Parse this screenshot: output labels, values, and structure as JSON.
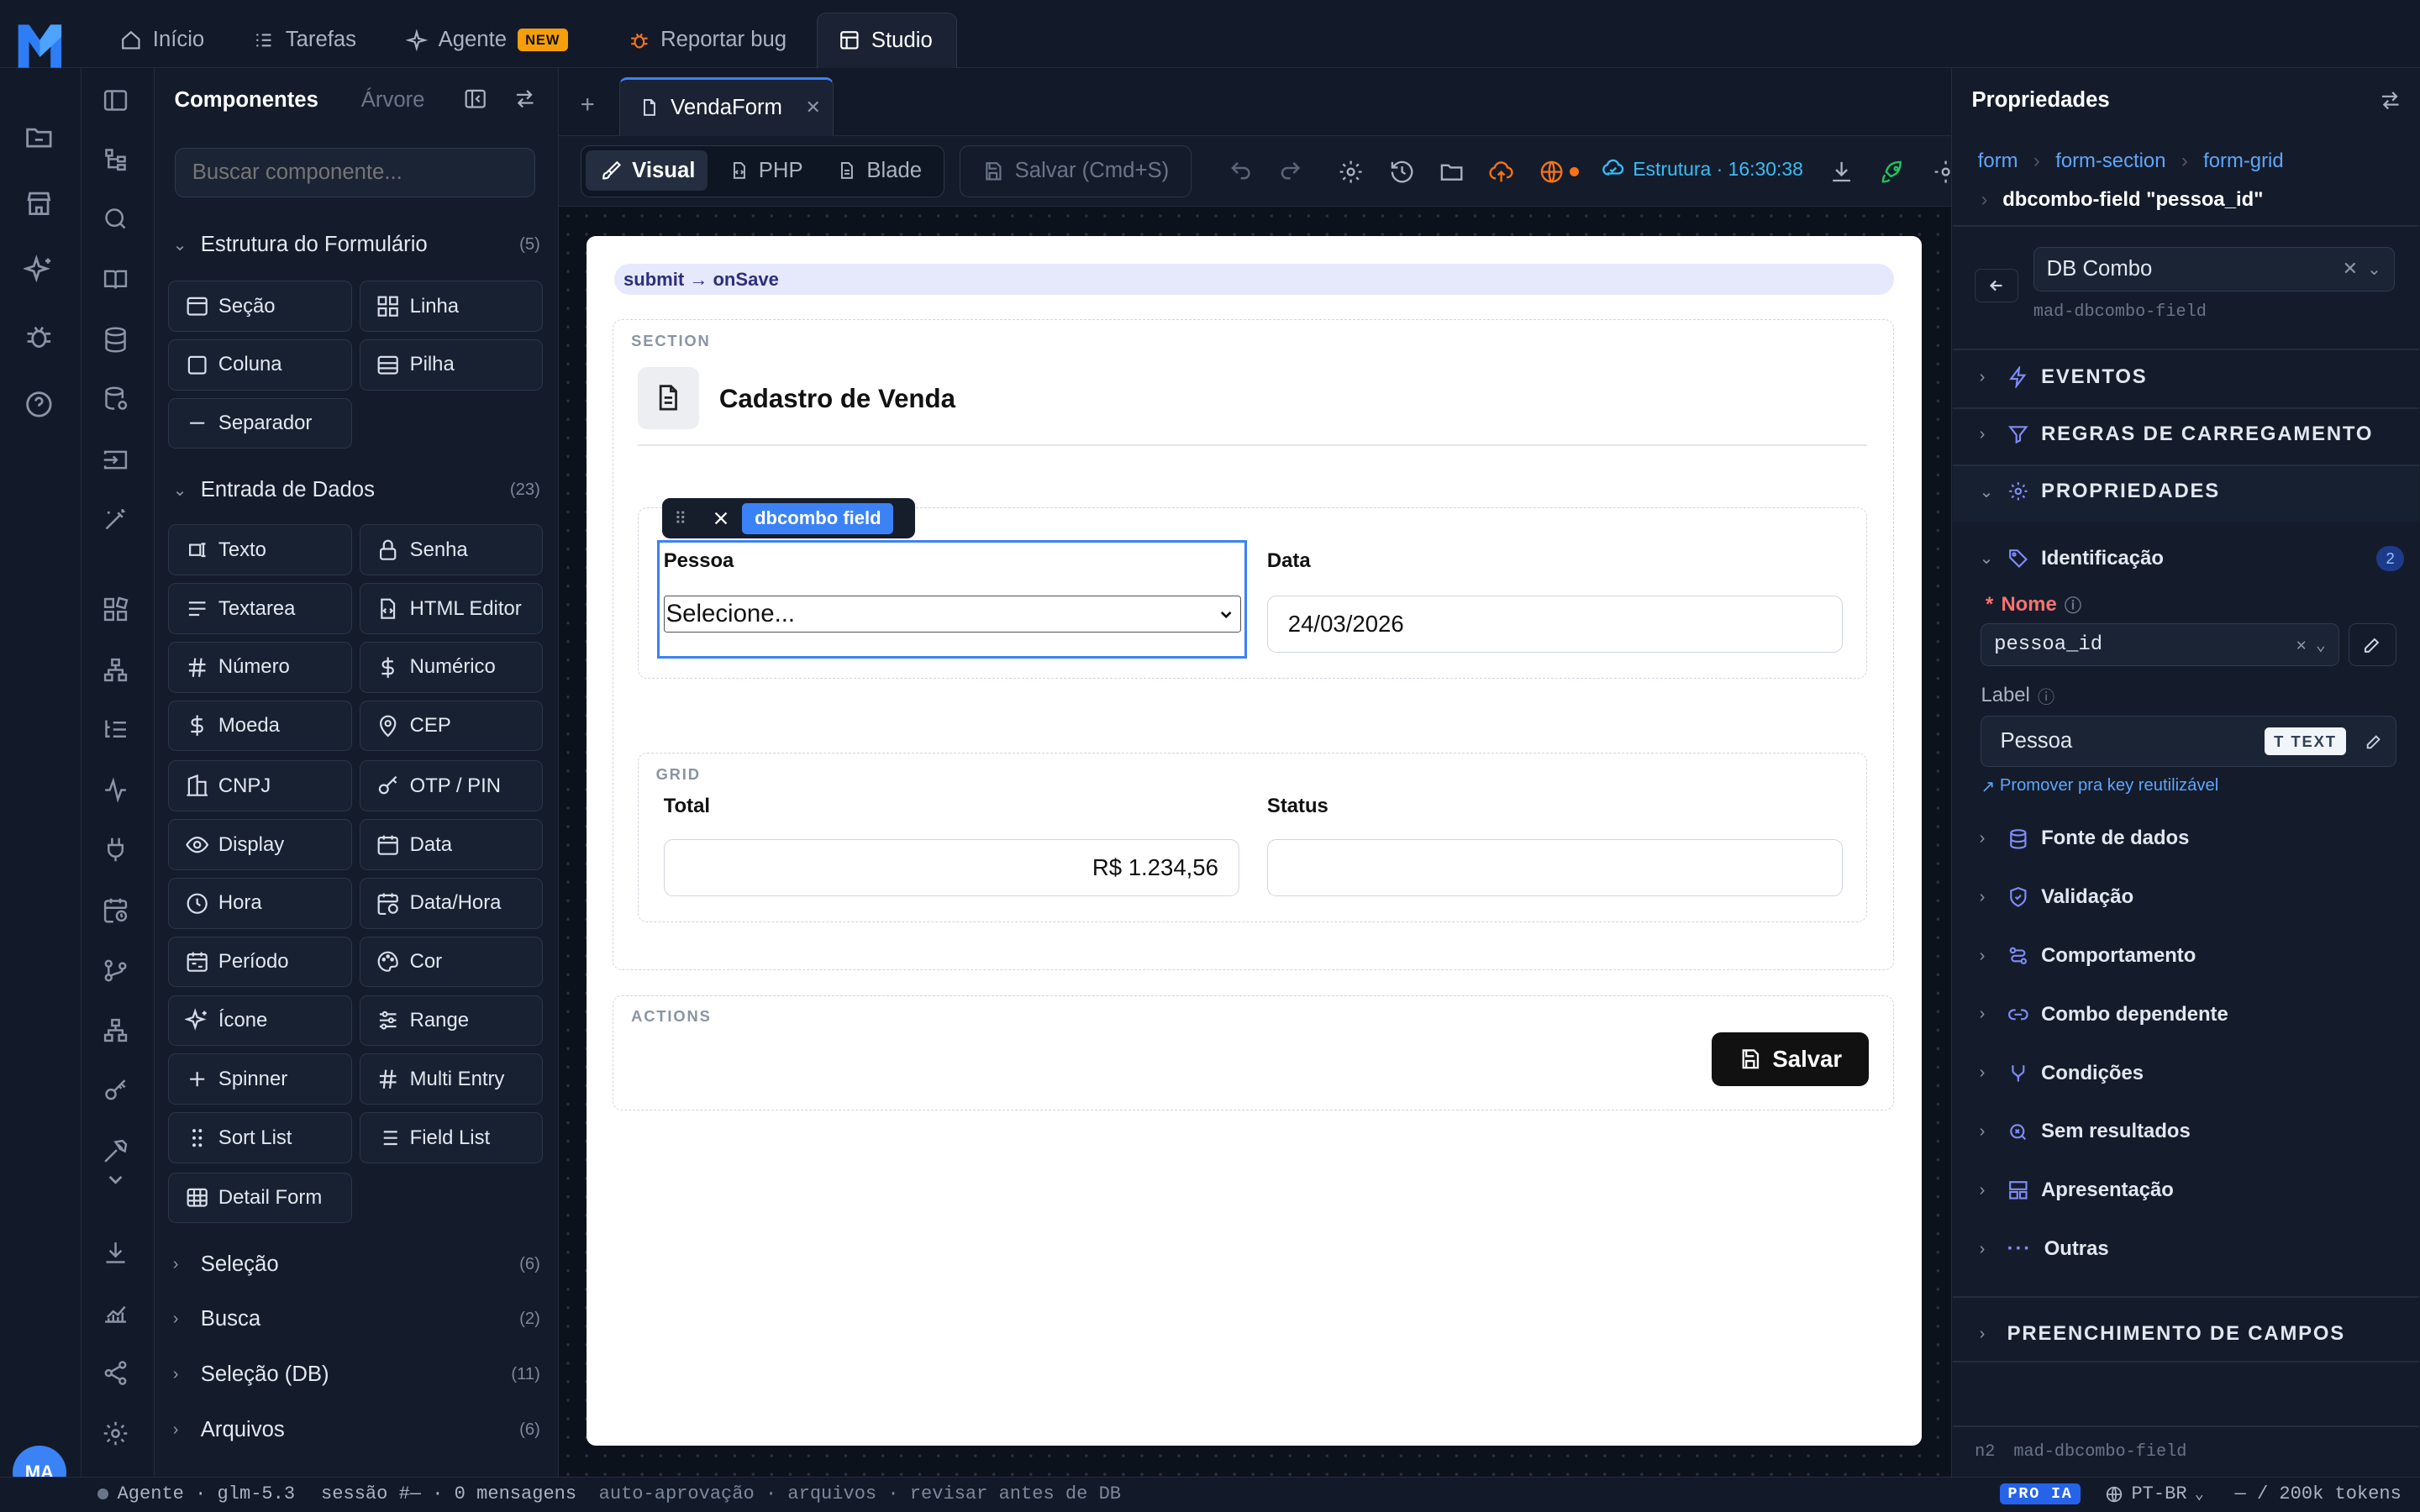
{
  "top_nav": {
    "tabs": [
      {
        "label": "Início",
        "icon": "home-icon"
      },
      {
        "label": "Tarefas",
        "icon": "tasks-icon"
      },
      {
        "label": "Agente",
        "icon": "sparkle-icon",
        "badge": "NEW"
      },
      {
        "label": "Reportar bug",
        "icon": "bug-icon"
      },
      {
        "label": "Studio",
        "icon": "layout-icon",
        "active": true
      }
    ]
  },
  "left_rail": {
    "avatar": "MA"
  },
  "components_panel": {
    "tab_components": "Componentes",
    "tab_tree": "Árvore",
    "search_placeholder": "Buscar componente...",
    "sections": [
      {
        "title": "Estrutura do Formulário",
        "count": "(5)",
        "expanded": true,
        "items": [
          "Seção",
          "Linha",
          "Coluna",
          "Pilha",
          "Separador"
        ]
      },
      {
        "title": "Entrada de Dados",
        "count": "(23)",
        "expanded": true,
        "items": [
          "Texto",
          "Senha",
          "Textarea",
          "HTML Editor",
          "Número",
          "Numérico",
          "Moeda",
          "CEP",
          "CNPJ",
          "OTP / PIN",
          "Display",
          "Data",
          "Hora",
          "Data/Hora",
          "Período",
          "Cor",
          "Ícone",
          "Range",
          "Spinner",
          "Multi Entry",
          "Sort List",
          "Field List",
          "Detail Form"
        ]
      },
      {
        "title": "Seleção",
        "count": "(6)",
        "expanded": false
      },
      {
        "title": "Busca",
        "count": "(2)",
        "expanded": false
      },
      {
        "title": "Seleção (DB)",
        "count": "(11)",
        "expanded": false
      },
      {
        "title": "Arquivos",
        "count": "(6)",
        "expanded": false
      }
    ]
  },
  "editor": {
    "file_tab": "VendaForm",
    "view_modes": [
      "Visual",
      "PHP",
      "Blade"
    ],
    "active_mode": "Visual",
    "save_label": "Salvar (Cmd+S)",
    "structure_status": "Estrutura · 16:30:38"
  },
  "form": {
    "submit_hint": "submit → onSave",
    "section_label": "SECTION",
    "title": "Cadastro de Venda",
    "selection_toolbar_label": "dbcombo field",
    "row_fields": [
      {
        "label": "Pessoa",
        "type": "select",
        "value": "Selecione..."
      },
      {
        "label": "Data",
        "type": "input",
        "value": "24/03/2026"
      }
    ],
    "grid_label": "GRID",
    "grid_fields": [
      {
        "label": "Total",
        "value": "R$ 1.234,56"
      },
      {
        "label": "Status",
        "value": ""
      }
    ],
    "actions_label": "ACTIONS",
    "save_button": "Salvar"
  },
  "properties": {
    "title": "Propriedades",
    "breadcrumb": [
      "form",
      "form-section",
      "form-grid"
    ],
    "selected": "dbcombo-field \"pessoa_id\"",
    "component_type": "DB Combo",
    "component_id": "mad-dbcombo-field",
    "groups": [
      "EVENTOS",
      "REGRAS DE CARREGAMENTO",
      "PROPRIEDADES"
    ],
    "identification": {
      "title": "Identificação",
      "count": "2",
      "name_label": "Nome",
      "name_value": "pessoa_id",
      "label_label": "Label",
      "label_value": "Pessoa",
      "label_type": "TEXT",
      "promote_link": "Promover pra key reutilizável"
    },
    "subgroups": [
      {
        "label": "Fonte de dados",
        "icon": "database-icon"
      },
      {
        "label": "Validação",
        "icon": "shield-icon"
      },
      {
        "label": "Comportamento",
        "icon": "route-icon"
      },
      {
        "label": "Combo dependente",
        "icon": "link-icon"
      },
      {
        "label": "Condições",
        "icon": "branch-icon"
      },
      {
        "label": "Sem resultados",
        "icon": "search-icon"
      },
      {
        "label": "Apresentação",
        "icon": "layout-icon"
      },
      {
        "label": "Outras",
        "icon": "dots-icon"
      }
    ],
    "fill_group": "PREENCHIMENTO DE CAMPOS",
    "footer_level": "n2",
    "footer_id": "mad-dbcombo-field"
  },
  "status_bar": {
    "agent": "Agente · glm-5.3",
    "session": "sessão #— · 0 mensagens",
    "mode": "auto-aprovação · arquivos · revisar antes de DB",
    "plan_badge": "PRO IA",
    "language": "PT-BR",
    "tokens": "— / 200k tokens"
  },
  "colors": {
    "accent": "#3b82f6",
    "brand_blue": "#2563eb",
    "badge_orange": "#f59e0b",
    "required_red": "#f87171"
  }
}
